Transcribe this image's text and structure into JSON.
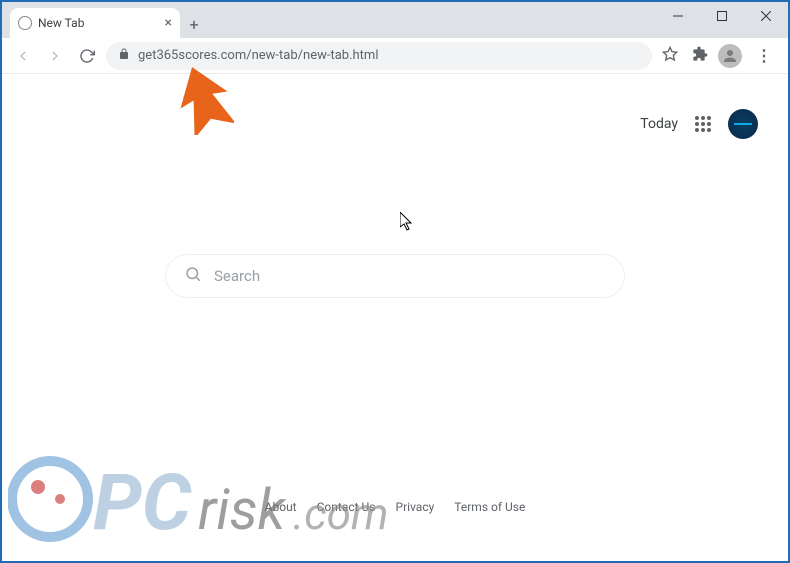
{
  "window": {
    "tab_title": "New Tab",
    "min_label": "–",
    "max_label": "□",
    "close_label": "×"
  },
  "addressbar": {
    "url": "get365scores.com/new-tab/new-tab.html"
  },
  "topright": {
    "today_label": "Today"
  },
  "search": {
    "placeholder": "Search"
  },
  "footer": {
    "links": [
      "About",
      "Contact Us",
      "Privacy",
      "Terms of Use"
    ]
  },
  "watermark": {
    "text_pc": "PC",
    "text_risk": "risk",
    "text_com": ".com"
  }
}
